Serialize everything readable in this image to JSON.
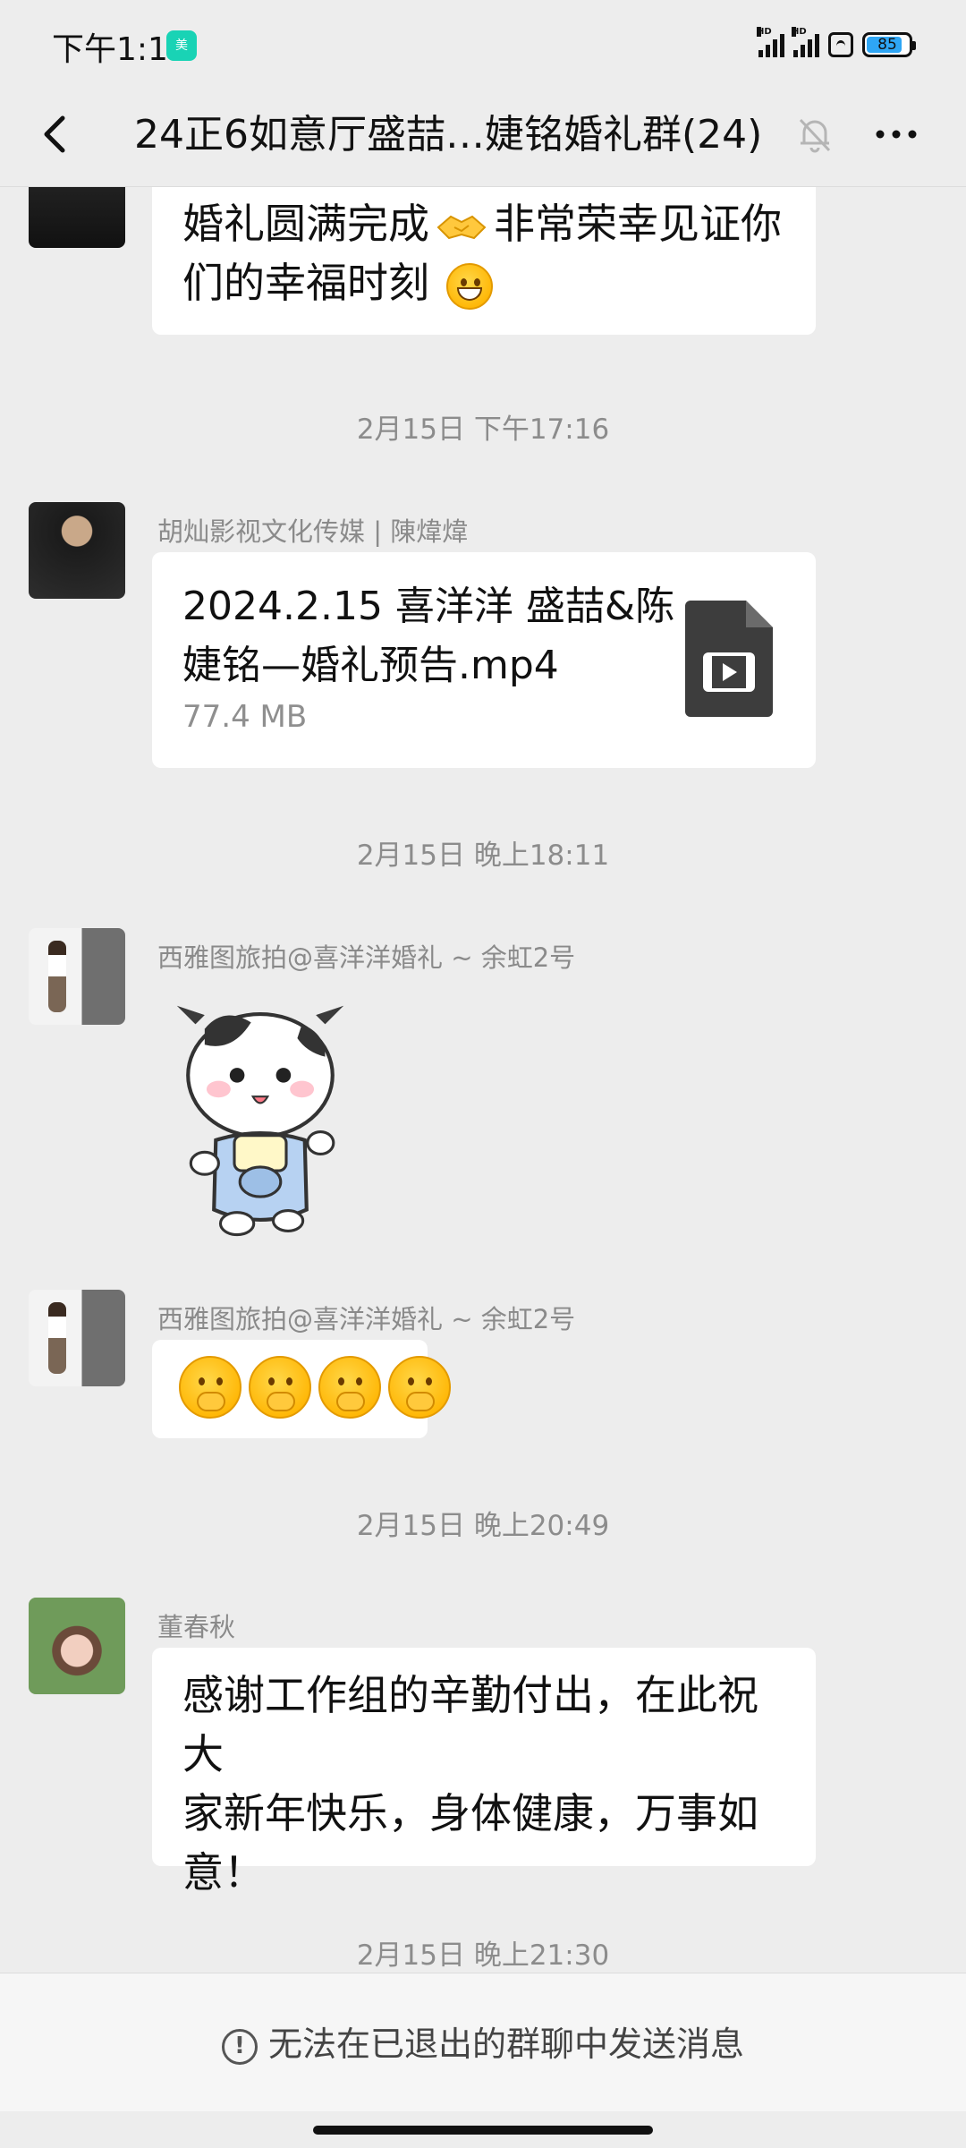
{
  "status_bar": {
    "time": "下午1:11",
    "app_badge": "美",
    "signal_label": "HD",
    "battery": "85"
  },
  "header": {
    "title": "24正6如意厅盛喆…婕铭婚礼群(24)",
    "back_icon": "chevron-left-icon",
    "mute_icon": "bell-off-icon",
    "more_icon": "more-dots-icon"
  },
  "messages": {
    "m0": {
      "text_line1": "婚礼圆满完成",
      "text_line1b": "非常荣幸见证你",
      "text_line2": "们的幸福时刻"
    },
    "t1": "2月15日 下午17:16",
    "m1": {
      "sender": "胡灿影视文化传媒 | 陳煒煒",
      "file_name_line1": "2024.2.15 喜洋洋 盛喆&陈",
      "file_name_line2": "婕铭—婚礼预告.mp4",
      "file_size": "77.4 MB"
    },
    "t2": "2月15日 晚上18:11",
    "m2": {
      "sender": "西雅图旅拍@喜洋洋婚礼 ~ 余虹2号",
      "sticker": "cow-sticker"
    },
    "m3": {
      "sender": "西雅图旅拍@喜洋洋婚礼 ~ 余虹2号",
      "emoji": "giggle-emoji"
    },
    "t3": "2月15日 晚上20:49",
    "m4": {
      "sender": "董春秋",
      "line1": "感谢工作组的辛勤付出，在此祝大",
      "line2": "家新年快乐，身体健康，万事如",
      "line3": "意！"
    },
    "t4": "2月15日 晚上21:30"
  },
  "footer": {
    "notice": "无法在已退出的群聊中发送消息"
  }
}
